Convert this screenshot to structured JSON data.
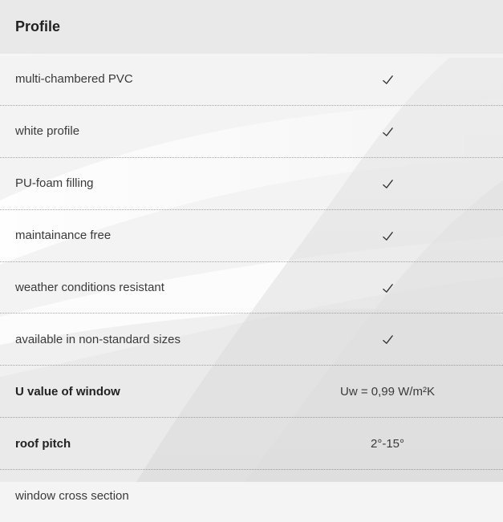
{
  "header": {
    "title": "Profile"
  },
  "rows": [
    {
      "label": "multi-chambered PVC",
      "value_type": "check",
      "value": "✓",
      "icon": "check-icon"
    },
    {
      "label": "white profile",
      "value_type": "check",
      "value": "✓",
      "icon": "check-icon"
    },
    {
      "label": "PU-foam filling",
      "value_type": "check",
      "value": "✓",
      "icon": "check-icon"
    },
    {
      "label": "maintainance free",
      "value_type": "check",
      "value": "✓",
      "icon": "check-icon"
    },
    {
      "label": "weather conditions resistant",
      "value_type": "check",
      "value": "✓",
      "icon": "check-icon"
    },
    {
      "label": "available in non-standard sizes",
      "value_type": "check",
      "value": "✓",
      "icon": "check-icon"
    },
    {
      "label": "U value of window",
      "value_type": "text",
      "value": "Uw =  0,99 W/m²K",
      "bold": true
    },
    {
      "label": "roof pitch",
      "value_type": "text",
      "value": "2°-15°",
      "bold": true
    },
    {
      "label": "window cross section",
      "value_type": "text",
      "value": ""
    }
  ],
  "colors": {
    "background": "#f4f4f4",
    "header_background": "#e8e8e8",
    "text": "#333333",
    "divider": "#646464"
  }
}
